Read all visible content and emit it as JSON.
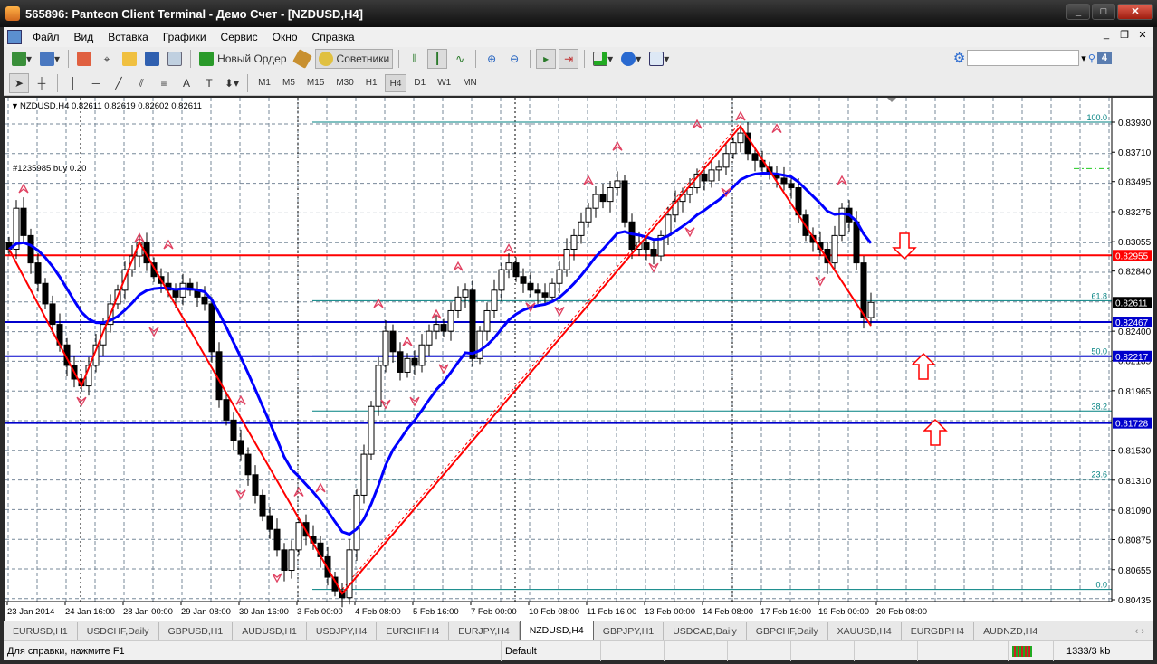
{
  "window": {
    "title": "565896: Panteon Client Terminal - Демо Счет - [NZDUSD,H4]"
  },
  "menu": [
    "Файл",
    "Вид",
    "Вставка",
    "Графики",
    "Сервис",
    "Окно",
    "Справка"
  ],
  "toolbar": {
    "new_order": "Новый Ордер",
    "experts": "Советники",
    "notifications": "4",
    "search_placeholder": ""
  },
  "timeframes": [
    "M1",
    "M5",
    "M15",
    "M30",
    "H1",
    "H4",
    "D1",
    "W1",
    "MN"
  ],
  "active_timeframe": "H4",
  "tabs": [
    "EURUSD,H1",
    "USDCHF,Daily",
    "GBPUSD,H1",
    "AUDUSD,H1",
    "USDJPY,H4",
    "EURCHF,H4",
    "EURJPY,H4",
    "NZDUSD,H4",
    "GBPJPY,H1",
    "USDCAD,Daily",
    "GBPCHF,Daily",
    "XAUUSD,H4",
    "EURGBP,H4",
    "AUDNZD,H4"
  ],
  "active_tab": "NZDUSD,H4",
  "status": {
    "help": "Для справки, нажмите F1",
    "profile": "Default",
    "traffic": "1333/3 kb"
  },
  "colors": {
    "bg": "#ffffff",
    "grid": "#778899",
    "ma": "#0000ff",
    "zigzag": "#ff0000",
    "fibo": "#008080",
    "bull": "#ffffff",
    "bear": "#000000"
  },
  "chart_data": {
    "type": "candlestick",
    "symbol_header": "NZDUSD,H4  0.82611 0.82619 0.82602 0.82611",
    "order_label": "#1235985 buy 0.20",
    "order_price": 0.8359,
    "ylim": [
      0.803,
      0.841
    ],
    "y_ticks": [
      0.8393,
      0.8371,
      0.83495,
      0.83275,
      0.83055,
      0.8284,
      0.824,
      0.82185,
      0.81965,
      0.8153,
      0.8131,
      0.8109,
      0.80875,
      0.80655,
      0.80435
    ],
    "x_ticks": [
      "23 Jan 2014",
      "24 Jan 16:00",
      "28 Jan 00:00",
      "29 Jan 08:00",
      "30 Jan 16:00",
      "3 Feb 00:00",
      "4 Feb 08:00",
      "5 Feb 16:00",
      "7 Feb 00:00",
      "10 Feb 08:00",
      "11 Feb 16:00",
      "13 Feb 00:00",
      "14 Feb 08:00",
      "17 Feb 16:00",
      "19 Feb 00:00",
      "20 Feb 08:00"
    ],
    "closes": [
      0.83,
      0.833,
      0.831,
      0.829,
      0.8275,
      0.826,
      0.8245,
      0.823,
      0.8215,
      0.8205,
      0.82,
      0.8215,
      0.823,
      0.8245,
      0.826,
      0.827,
      0.8285,
      0.8295,
      0.8305,
      0.829,
      0.828,
      0.8275,
      0.827,
      0.8265,
      0.8275,
      0.827,
      0.8265,
      0.826,
      0.8225,
      0.819,
      0.8175,
      0.816,
      0.815,
      0.8135,
      0.812,
      0.8105,
      0.8095,
      0.808,
      0.8065,
      0.808,
      0.81,
      0.809,
      0.8085,
      0.8075,
      0.806,
      0.805,
      0.8045,
      0.808,
      0.812,
      0.815,
      0.8185,
      0.8215,
      0.824,
      0.8225,
      0.821,
      0.822,
      0.8215,
      0.823,
      0.824,
      0.8245,
      0.824,
      0.8255,
      0.8265,
      0.827,
      0.822,
      0.824,
      0.8255,
      0.827,
      0.8285,
      0.829,
      0.828,
      0.8275,
      0.827,
      0.8268,
      0.8265,
      0.8275,
      0.8285,
      0.83,
      0.831,
      0.832,
      0.833,
      0.834,
      0.8335,
      0.8345,
      0.835,
      0.832,
      0.83,
      0.8305,
      0.83,
      0.8295,
      0.831,
      0.8325,
      0.8335,
      0.834,
      0.8345,
      0.8355,
      0.835,
      0.8358,
      0.836,
      0.837,
      0.8378,
      0.8385,
      0.837,
      0.8365,
      0.836,
      0.8355,
      0.8352,
      0.8348,
      0.8345,
      0.8325,
      0.831,
      0.8305,
      0.83,
      0.829,
      0.831,
      0.833,
      0.832,
      0.829,
      0.825,
      0.82611
    ],
    "ma_period": 14,
    "zigzag": [
      [
        0,
        0.83
      ],
      [
        10,
        0.82
      ],
      [
        18,
        0.8305
      ],
      [
        46,
        0.8048
      ],
      [
        101,
        0.839
      ],
      [
        119,
        0.8244
      ]
    ],
    "fractals_up": [
      [
        2,
        0.8344
      ],
      [
        18,
        0.8308
      ],
      [
        22,
        0.8303
      ],
      [
        32,
        0.8189
      ],
      [
        40,
        0.8122
      ],
      [
        43,
        0.8125
      ],
      [
        51,
        0.826
      ],
      [
        55,
        0.8232
      ],
      [
        59,
        0.8252
      ],
      [
        62,
        0.8287
      ],
      [
        69,
        0.83
      ],
      [
        80,
        0.835
      ],
      [
        84,
        0.8375
      ],
      [
        95,
        0.8391
      ],
      [
        101,
        0.8397
      ],
      [
        106,
        0.8388
      ],
      [
        115,
        0.835
      ]
    ],
    "fractals_down": [
      [
        10,
        0.8189
      ],
      [
        20,
        0.824
      ],
      [
        32,
        0.8121
      ],
      [
        37,
        0.806
      ],
      [
        52,
        0.8187
      ],
      [
        56,
        0.8189
      ],
      [
        60,
        0.8213
      ],
      [
        72,
        0.8258
      ],
      [
        76,
        0.8255
      ],
      [
        89,
        0.8287
      ],
      [
        94,
        0.8313
      ],
      [
        99,
        0.8342
      ],
      [
        112,
        0.8277
      ]
    ],
    "hlines": [
      {
        "price": 0.82955,
        "label": "0.82955",
        "color": "#ff0000"
      },
      {
        "price": 0.82467,
        "label": "0.82467",
        "color": "#0000cc"
      },
      {
        "price": 0.82217,
        "label": "0.82217",
        "color": "#0000cc"
      },
      {
        "price": 0.81728,
        "label": "0.81728",
        "color": "#0000cc"
      }
    ],
    "bid": {
      "price": 0.82611,
      "label": "0.82611"
    },
    "fibo": {
      "low": 0.8051,
      "high": 0.8393,
      "levels": [
        {
          "pct": 0.0,
          "label": "0.0"
        },
        {
          "pct": 23.6,
          "label": "23.6"
        },
        {
          "pct": 38.2,
          "label": "38.2"
        },
        {
          "pct": 50.0,
          "label": "50.0"
        },
        {
          "pct": 61.8,
          "label": "61.8"
        },
        {
          "pct": 100.0,
          "label": "100.0"
        }
      ]
    }
  }
}
